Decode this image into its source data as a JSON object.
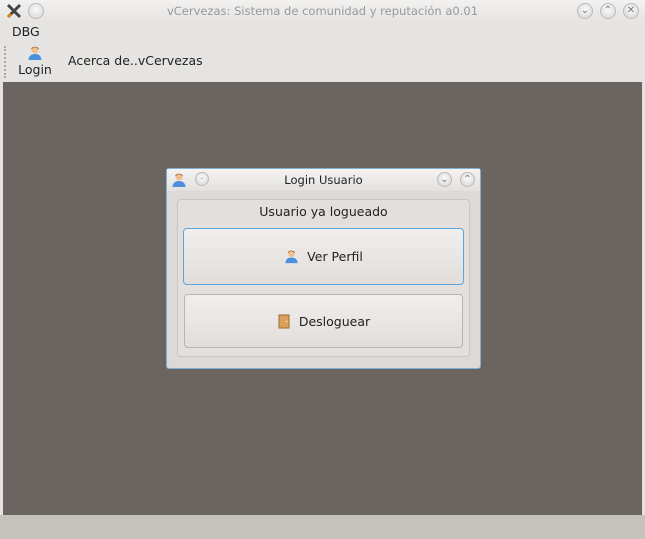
{
  "window": {
    "title": "vCervezas: Sistema de comunidad y reputación a0.01"
  },
  "menu": {
    "dbg": "DBG"
  },
  "toolbar": {
    "login": "Login",
    "about": "Acerca de..vCervezas"
  },
  "dialog": {
    "title": "Login Usuario",
    "status": "Usuario ya logueado",
    "view_profile": "Ver Perfil",
    "logout": "Desloguear"
  }
}
